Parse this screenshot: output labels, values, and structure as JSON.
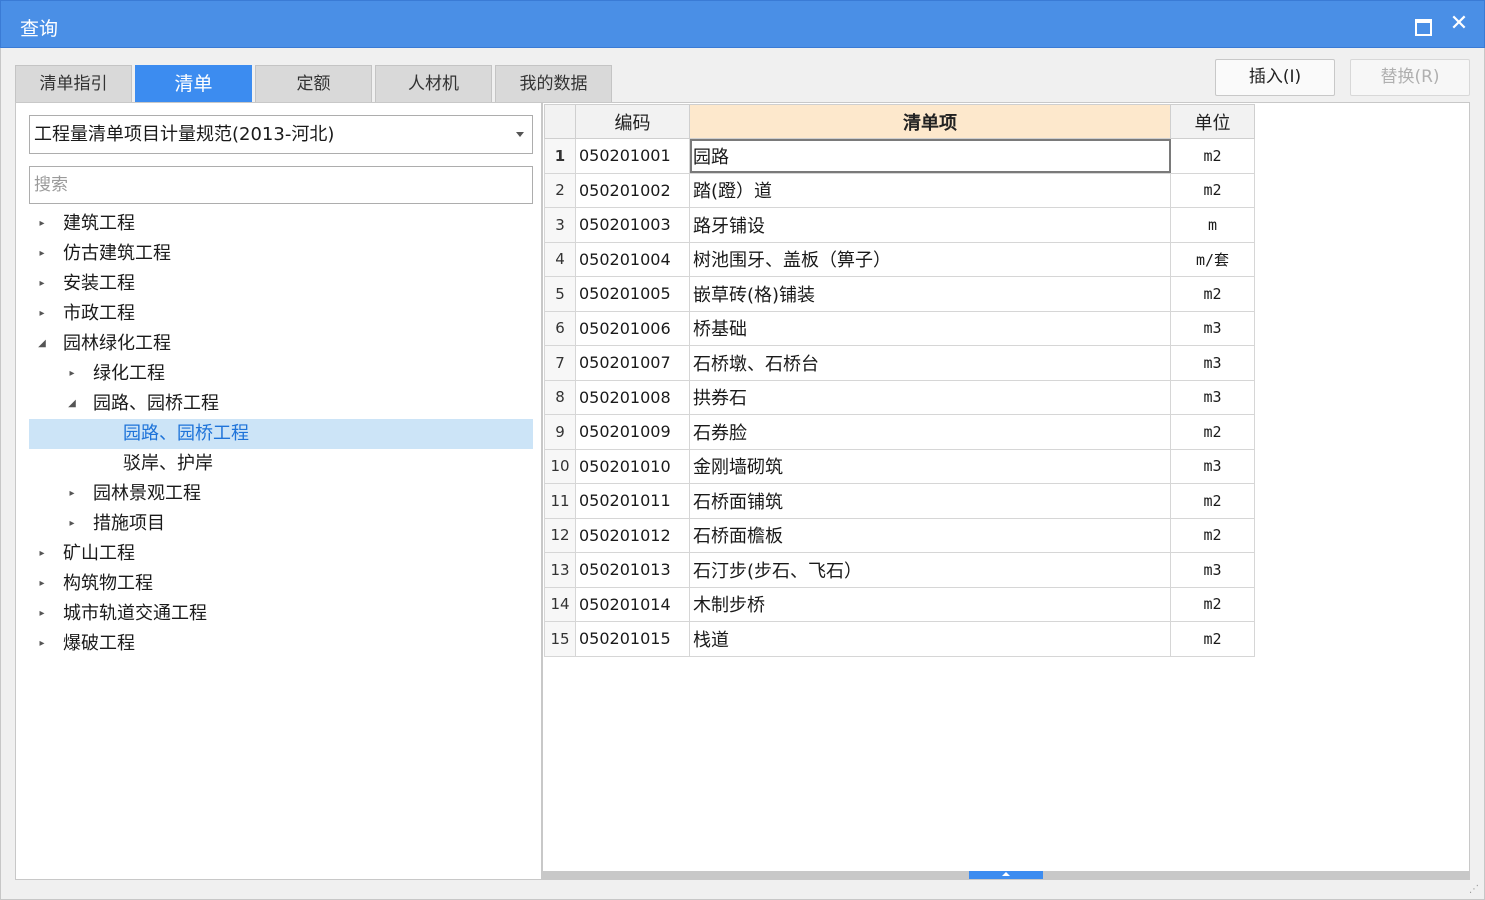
{
  "window": {
    "title": "查询",
    "close_glyph": "✕"
  },
  "tabs": [
    {
      "label": "清单指引",
      "active": false
    },
    {
      "label": "清单",
      "active": true
    },
    {
      "label": "定额",
      "active": false
    },
    {
      "label": "人材机",
      "active": false
    },
    {
      "label": "我的数据",
      "active": false
    }
  ],
  "toolbar": {
    "insert_label": "插入(I)",
    "replace_label": "替换(R)"
  },
  "left": {
    "spec_selected": "工程量清单项目计量规范(2013-河北)",
    "search_placeholder": "搜索",
    "tree": [
      {
        "label": "建筑工程",
        "depth": 0,
        "state": "collapsed"
      },
      {
        "label": "仿古建筑工程",
        "depth": 0,
        "state": "collapsed"
      },
      {
        "label": "安装工程",
        "depth": 0,
        "state": "collapsed"
      },
      {
        "label": "市政工程",
        "depth": 0,
        "state": "collapsed"
      },
      {
        "label": "园林绿化工程",
        "depth": 0,
        "state": "expanded"
      },
      {
        "label": "绿化工程",
        "depth": 1,
        "state": "collapsed"
      },
      {
        "label": "园路、园桥工程",
        "depth": 1,
        "state": "expanded"
      },
      {
        "label": "园路、园桥工程",
        "depth": 2,
        "state": "leaf",
        "selected": true
      },
      {
        "label": "驳岸、护岸",
        "depth": 2,
        "state": "leaf"
      },
      {
        "label": "园林景观工程",
        "depth": 1,
        "state": "collapsed"
      },
      {
        "label": "措施项目",
        "depth": 1,
        "state": "collapsed"
      },
      {
        "label": "矿山工程",
        "depth": 0,
        "state": "collapsed"
      },
      {
        "label": "构筑物工程",
        "depth": 0,
        "state": "collapsed"
      },
      {
        "label": "城市轨道交通工程",
        "depth": 0,
        "state": "collapsed"
      },
      {
        "label": "爆破工程",
        "depth": 0,
        "state": "collapsed"
      }
    ]
  },
  "grid": {
    "columns": {
      "code": "编码",
      "name": "清单项",
      "unit": "单位"
    },
    "rows": [
      {
        "no": "1",
        "code": "050201001",
        "name": "园路",
        "unit": "m2"
      },
      {
        "no": "2",
        "code": "050201002",
        "name": "踏(蹬）道",
        "unit": "m2"
      },
      {
        "no": "3",
        "code": "050201003",
        "name": "路牙铺设",
        "unit": "m"
      },
      {
        "no": "4",
        "code": "050201004",
        "name": "树池围牙、盖板（箅子）",
        "unit": "m/套"
      },
      {
        "no": "5",
        "code": "050201005",
        "name": "嵌草砖(格)铺装",
        "unit": "m2"
      },
      {
        "no": "6",
        "code": "050201006",
        "name": "桥基础",
        "unit": "m3"
      },
      {
        "no": "7",
        "code": "050201007",
        "name": "石桥墩、石桥台",
        "unit": "m3"
      },
      {
        "no": "8",
        "code": "050201008",
        "name": "拱券石",
        "unit": "m3"
      },
      {
        "no": "9",
        "code": "050201009",
        "name": "石券脸",
        "unit": "m2"
      },
      {
        "no": "10",
        "code": "050201010",
        "name": "金刚墙砌筑",
        "unit": "m3"
      },
      {
        "no": "11",
        "code": "050201011",
        "name": "石桥面铺筑",
        "unit": "m2"
      },
      {
        "no": "12",
        "code": "050201012",
        "name": "石桥面檐板",
        "unit": "m2"
      },
      {
        "no": "13",
        "code": "050201013",
        "name": "石汀步(步石、飞石）",
        "unit": "m3"
      },
      {
        "no": "14",
        "code": "050201014",
        "name": "木制步桥",
        "unit": "m2"
      },
      {
        "no": "15",
        "code": "050201015",
        "name": "栈道",
        "unit": "m2"
      }
    ]
  },
  "colors": {
    "titlebar": "#4a8fe6",
    "tab_active": "#3c8cf0",
    "tree_selected_bg": "#cce4f7",
    "tree_selected_text": "#1e73d9",
    "active_column_header": "#fde8cc"
  },
  "icons": {
    "tree_collapsed": "▸",
    "tree_expanded": "◢",
    "resize": "⋰"
  }
}
